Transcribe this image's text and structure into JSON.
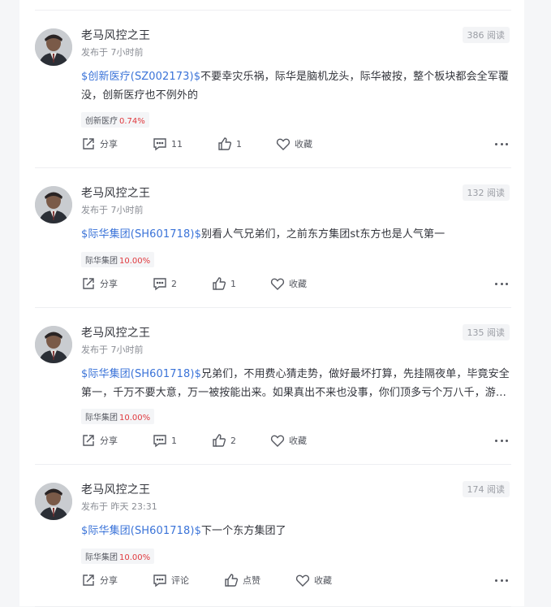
{
  "posts": [
    {
      "author": "老马风控之王",
      "time": "发布于 7小时前",
      "views": "386 阅读",
      "tag": "$创新医疗(SZ002173)$",
      "text": "不要幸灾乐祸，际华是脑机龙头，际华被按，整个板块都会全军覆没，创新医疗也不例外的",
      "stock_name": "创新医疗",
      "stock_change": "0.74%",
      "share": "分享",
      "comments": "11",
      "likes": "1",
      "collect": "收藏"
    },
    {
      "author": "老马风控之王",
      "time": "发布于 7小时前",
      "views": "132 阅读",
      "tag": "$际华集团(SH601718)$",
      "text": "别看人气兄弟们，之前东方集团st东方也是人气第一",
      "stock_name": "际华集团",
      "stock_change": "10.00%",
      "share": "分享",
      "comments": "2",
      "likes": "1",
      "collect": "收藏"
    },
    {
      "author": "老马风控之王",
      "time": "发布于 7小时前",
      "views": "135 阅读",
      "tag": "$际华集团(SH601718)$",
      "text": "兄弟们，不用费心猜走势，做好最坏打算，先挂隔夜单，毕竟安全第一，千万不要大意，万一被按能出来。如果真出不来也没事，你们顶多亏个万八千，游资是...",
      "stock_name": "际华集团",
      "stock_change": "10.00%",
      "share": "分享",
      "comments": "1",
      "likes": "2",
      "collect": "收藏"
    },
    {
      "author": "老马风控之王",
      "time": "发布于 昨天 23:31",
      "views": "174 阅读",
      "tag": "$际华集团(SH601718)$",
      "text": "下一个东方集团了",
      "stock_name": "际华集团",
      "stock_change": "10.00%",
      "share": "分享",
      "comments": "评论",
      "likes": "点赞",
      "collect": "收藏"
    }
  ],
  "colors": {
    "tag": "#3a73d8",
    "up": "#e0393e",
    "page_bg": "#f5f6f8"
  },
  "icons": [
    "share-icon",
    "comment-icon",
    "like-icon",
    "collect-icon",
    "more-icon"
  ]
}
